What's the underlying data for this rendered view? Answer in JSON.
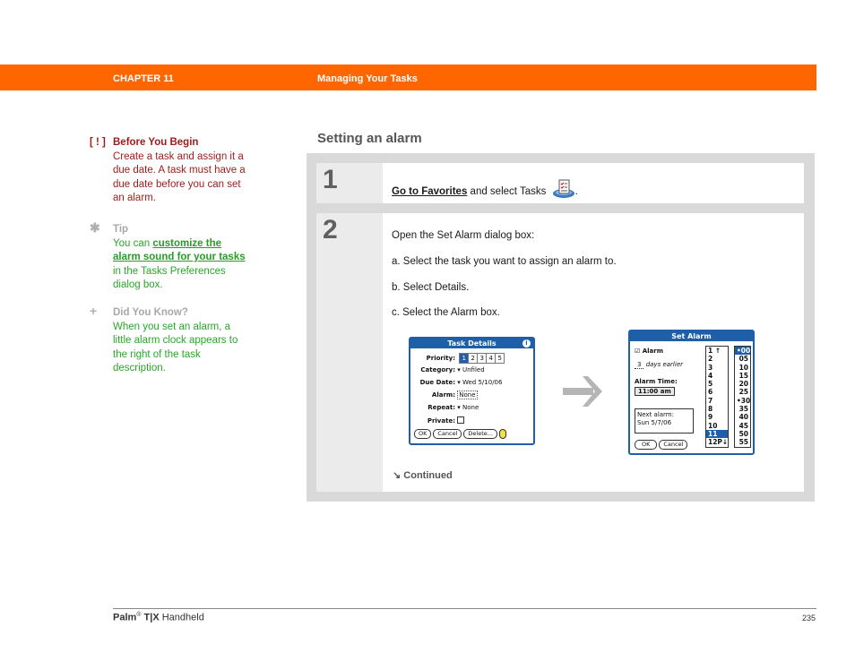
{
  "header": {
    "chapter": "CHAPTER 11",
    "title": "Managing Your Tasks",
    "bar_color": "#ff6600"
  },
  "sidebar": {
    "before_you_begin": {
      "mark": "[ ! ]",
      "heading": "Before You Begin",
      "text": "Create a task and assign it a due date. A task must have a due date before you can set an alarm."
    },
    "tip": {
      "icon": "asterisk-icon",
      "heading": "Tip",
      "text_before": "You can ",
      "link": "customize the alarm sound for your tasks",
      "text_after": " in the Tasks Preferences dialog box."
    },
    "did_you_know": {
      "icon": "plus-icon",
      "heading": "Did You Know?",
      "text": "When you set an alarm, a little alarm clock appears to the right of the task description."
    }
  },
  "section": {
    "title": "Setting an alarm"
  },
  "steps": [
    {
      "number": "1",
      "link": "Go to Favorites",
      "text": " and select Tasks",
      "icon": "tasks-app-icon",
      "end": "."
    },
    {
      "number": "2",
      "intro": "Open the Set Alarm dialog box:",
      "items": [
        "a.  Select the task you want to assign an alarm to.",
        "b.  Select Details.",
        "c.  Select the Alarm box."
      ],
      "continued": "Continued"
    }
  ],
  "task_details_dialog": {
    "title": "Task Details",
    "priority_label": "Priority:",
    "priorities": [
      "1",
      "2",
      "3",
      "4",
      "5"
    ],
    "selected_priority": "1",
    "category_label": "Category:",
    "category_value": "Unfiled",
    "due_date_label": "Due Date:",
    "due_date_value": "Wed 5/10/06",
    "alarm_label": "Alarm:",
    "alarm_value": "None",
    "repeat_label": "Repeat:",
    "repeat_value": "None",
    "private_label": "Private:",
    "buttons": [
      "OK",
      "Cancel",
      "Delete..."
    ]
  },
  "set_alarm_dialog": {
    "title": "Set Alarm",
    "alarm_checkbox_label": "Alarm",
    "alarm_checked": true,
    "days_value": "3",
    "days_label": "days earlier",
    "alarm_time_label": "Alarm Time:",
    "alarm_time_value": "11:00 am",
    "next_alarm_label": "Next alarm:",
    "next_alarm_value": "Sun 5/7/06",
    "buttons": [
      "OK",
      "Cancel"
    ],
    "hours": [
      "1",
      "2",
      "3",
      "4",
      "5",
      "6",
      "7",
      "8",
      "9",
      "10",
      "11",
      "12P"
    ],
    "selected_hour": "11",
    "minutes": [
      "•00",
      "05",
      "10",
      "15",
      "20",
      "25",
      "•30",
      "35",
      "40",
      "45",
      "50",
      "55"
    ],
    "selected_minute": "•00"
  },
  "footer": {
    "product_brand": "Palm",
    "product_reg": "®",
    "product_model": "T|X",
    "product_suffix": " Handheld",
    "page_number": "235"
  }
}
